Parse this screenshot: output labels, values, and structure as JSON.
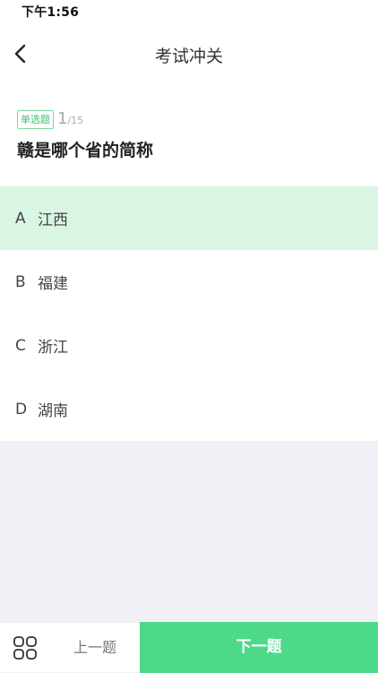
{
  "status_bar": {
    "time": "下午1:56"
  },
  "nav": {
    "title": "考试冲关",
    "back_icon": "chevron-left-icon"
  },
  "question": {
    "type_label": "单选题",
    "current": "1",
    "separator": "/",
    "total": "15",
    "text": "赣是哪个省的简称"
  },
  "options": [
    {
      "letter": "A",
      "text": "江西",
      "selected": true
    },
    {
      "letter": "B",
      "text": "福建",
      "selected": false
    },
    {
      "letter": "C",
      "text": "浙江",
      "selected": false
    },
    {
      "letter": "D",
      "text": "湖南",
      "selected": false
    }
  ],
  "bottom_bar": {
    "grid_icon": "grid-icon",
    "prev_label": "上一题",
    "next_label": "下一题"
  },
  "colors": {
    "accent": "#4ed98a",
    "selected_option_bg": "#d9f5e4",
    "badge_text": "#3cbf72",
    "page_bg": "#f1f0f6"
  }
}
